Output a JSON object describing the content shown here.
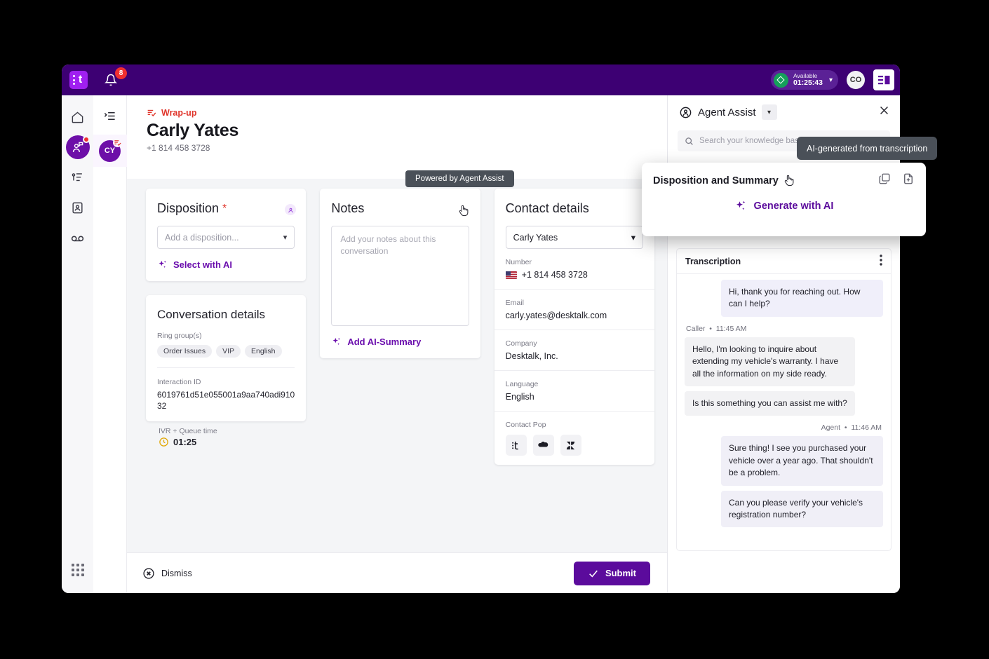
{
  "topbar": {
    "brand": "t",
    "notification_count": "8",
    "status_label": "Available",
    "status_timer": "01:25:43",
    "avatar_initials": "CO",
    "panel_toggle_icon": "panel-layout-icon"
  },
  "rail": {
    "items": [
      {
        "name": "home",
        "icon": "home-icon",
        "active": false,
        "badge": false
      },
      {
        "name": "conversations",
        "icon": "agent-headset-icon",
        "active": true,
        "badge": true
      },
      {
        "name": "queues",
        "icon": "queue-list-icon",
        "active": false,
        "badge": false
      },
      {
        "name": "contacts",
        "icon": "contact-card-icon",
        "active": false,
        "badge": false
      },
      {
        "name": "voicemail",
        "icon": "voicemail-icon",
        "active": false,
        "badge": false
      }
    ],
    "dialpad_icon": "dialpad-icon"
  },
  "conversation_strip": {
    "collapse_icon": "collapse-panel-icon",
    "avatar_initials": "CY",
    "avatar_badge_icon": "wrapup-icon"
  },
  "header": {
    "status": "Wrap-up",
    "status_icon": "wrapup-check-icon",
    "name": "Carly Yates",
    "phone": "+1 814 458 3728"
  },
  "disposition": {
    "title": "Disposition",
    "required_marker": "*",
    "badge_icon": "agent-assist-badge-icon",
    "select_placeholder": "Add a disposition...",
    "ai_link": "Select with AI",
    "ai_icon": "sparkle-icon",
    "chevron": "chevron-down-icon"
  },
  "conversation_details": {
    "title": "Conversation details",
    "ring_groups_label": "Ring group(s)",
    "ring_groups": [
      "Order Issues",
      "VIP",
      "English"
    ],
    "interaction_id_label": "Interaction ID",
    "interaction_id": "6019761d51e055001a9aa740adi91032",
    "ivr_label": "IVR + Queue time",
    "ivr_time": "01:25",
    "ivr_icon": "clock-icon"
  },
  "notes": {
    "title": "Notes",
    "placeholder": "Add your notes about this conversation",
    "ai_link": "Add AI-Summary",
    "ai_icon": "sparkle-icon",
    "cursor_icon": "pointing-hand-cursor"
  },
  "contact_details": {
    "title": "Contact details",
    "selected_contact": "Carly Yates",
    "chevron": "chevron-down-icon",
    "fields": [
      {
        "label": "Number",
        "value": "+1 814 458 3728",
        "has_flag": true
      },
      {
        "label": "Email",
        "value": "carly.yates@desktalk.com",
        "has_flag": false
      },
      {
        "label": "Company",
        "value": "Desktalk, Inc.",
        "has_flag": false
      },
      {
        "label": "Language",
        "value": "English",
        "has_flag": false
      }
    ],
    "contact_pop_label": "Contact Pop",
    "contact_pop_icons": [
      "talkdesk-icon",
      "salesforce-cloud-icon",
      "zendesk-icon"
    ]
  },
  "action_bar": {
    "dismiss_label": "Dismiss",
    "dismiss_icon": "circle-x-icon",
    "submit_label": "Submit",
    "submit_icon": "check-icon"
  },
  "agent_assist": {
    "title": "Agent Assist",
    "title_icon": "agent-assist-icon",
    "chevron": "chevron-down-icon",
    "close_icon": "close-icon",
    "search_placeholder": "Search your knowledge base",
    "search_icon": "search-icon"
  },
  "transcription": {
    "title": "Transcription",
    "menu_icon": "more-vertical-icon",
    "messages": [
      {
        "speaker": "",
        "time": "",
        "side": "agent",
        "texts": [
          "Hi, thank you for reaching out. How can I help?"
        ]
      },
      {
        "speaker": "Caller",
        "time": "11:45 AM",
        "side": "caller",
        "texts": [
          "Hello, I'm looking to inquire about extending my vehicle's warranty. I have all the information on my side ready.",
          "Is this something you can assist me with?"
        ]
      },
      {
        "speaker": "Agent",
        "time": "11:46 AM",
        "side": "agent",
        "texts": [
          "Sure thing! I see you purchased your vehicle over a year ago. That shouldn't be a problem.",
          "Can you please verify your vehicle's registration number?"
        ]
      }
    ]
  },
  "overlays": {
    "tooltip_powered": "Powered by Agent Assist",
    "tooltip_ai_generated": "AI-generated from transcription",
    "float_card": {
      "title": "Disposition and Summary",
      "copy_icon": "copy-icon",
      "insert_icon": "insert-document-icon",
      "generate_label": "Generate with AI",
      "generate_icon": "sparkle-icon",
      "cursor_icon": "pointing-hand-cursor"
    }
  },
  "colors": {
    "brand_purple": "#3d0073",
    "accent_purple": "#6a0dad",
    "submit_purple": "#5b0b9c",
    "wrapup_red": "#e0352b",
    "badge_red": "#f03030",
    "available_green": "#15a05a"
  }
}
